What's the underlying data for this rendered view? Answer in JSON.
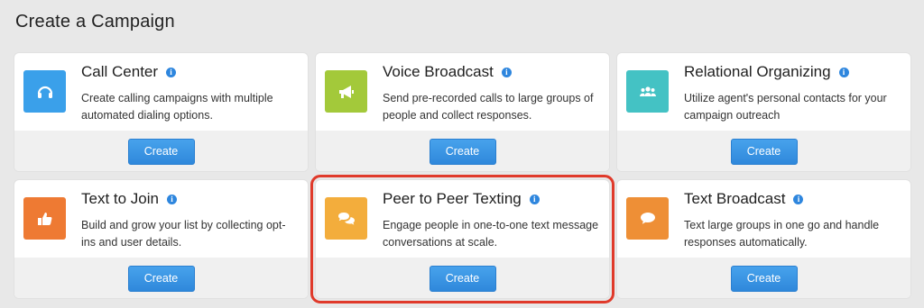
{
  "page": {
    "title": "Create a Campaign"
  },
  "colors": {
    "accent_button": "#3592e0",
    "info_icon": "#2e86de",
    "highlight_border": "#e03a2b"
  },
  "cards": [
    {
      "title": "Call Center",
      "description": "Create calling campaigns with multiple automated dialing options.",
      "button_label": "Create",
      "icon": "headset-icon",
      "icon_color": "#3aa0ea"
    },
    {
      "title": "Voice Broadcast",
      "description": "Send pre-recorded calls to large groups of people and collect responses.",
      "button_label": "Create",
      "icon": "megaphone-icon",
      "icon_color": "#a3c93a"
    },
    {
      "title": "Relational Organizing",
      "description": "Utilize agent's personal contacts for your campaign outreach",
      "button_label": "Create",
      "icon": "group-icon",
      "icon_color": "#44c2c4"
    },
    {
      "title": "Text to Join",
      "description": "Build and grow your list by collecting opt-ins and user details.",
      "button_label": "Create",
      "icon": "thumbs-up-icon",
      "icon_color": "#ee7a33"
    },
    {
      "title": "Peer to Peer Texting",
      "description": "Engage people in one-to-one text message conversations at scale.",
      "button_label": "Create",
      "icon": "chat-bubbles-icon",
      "icon_color": "#f3ad3c",
      "highlighted": true
    },
    {
      "title": "Text Broadcast",
      "description": "Text large groups in one go and handle responses automatically.",
      "button_label": "Create",
      "icon": "speech-bubble-icon",
      "icon_color": "#ee8f36"
    }
  ]
}
